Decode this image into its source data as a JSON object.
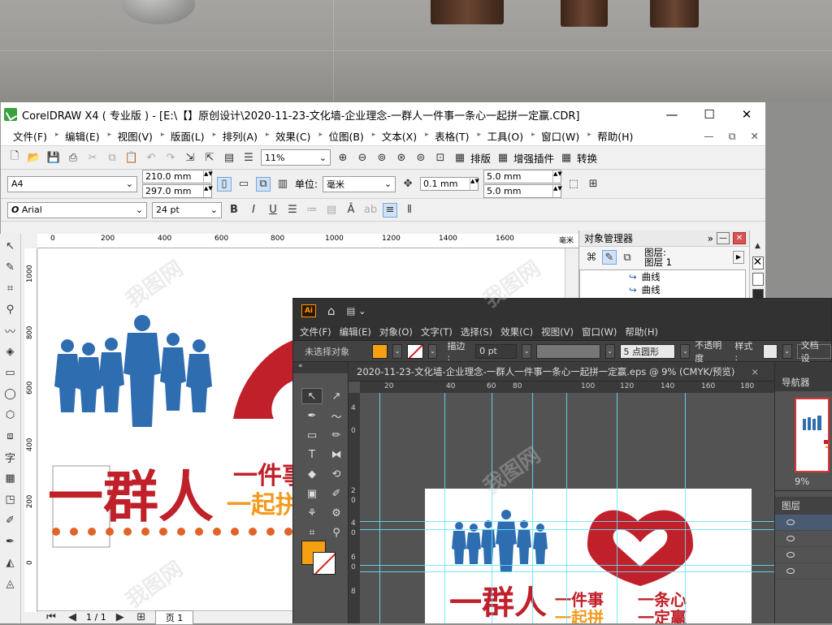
{
  "corel": {
    "title": "CorelDRAW X4 ( 专业版 ) - [E:\\【】原创设计\\2020-11-23-文化墙-企业理念-一群人一件事一条心一起拼一定赢.CDR]",
    "window_controls": [
      "—",
      "☐",
      "✕"
    ],
    "menu": [
      "文件(F)",
      "编辑(E)",
      "视图(V)",
      "版面(L)",
      "排列(A)",
      "效果(C)",
      "位图(B)",
      "文本(X)",
      "表格(T)",
      "工具(O)",
      "窗口(W)",
      "帮助(H)"
    ],
    "menu_right": [
      "—",
      "⧉",
      "✕"
    ],
    "toolbar1": {
      "zoom": "11%",
      "buttons": [
        "排版",
        "增强插件",
        "转换"
      ]
    },
    "toolbar2": {
      "page_size": "A4",
      "width": "210.0 mm",
      "height": "297.0 mm",
      "unit_label": "单位:",
      "unit": "毫米",
      "nudge": "0.1 mm",
      "dup_x": "5.0 mm",
      "dup_y": "5.0 mm"
    },
    "toolbar3": {
      "font": "Arial",
      "font_size": "24 pt",
      "font_glyph": "O"
    },
    "hruler": {
      "ticks": [
        "0",
        "200",
        "400",
        "600",
        "800",
        "1000",
        "1200",
        "1400",
        "1600"
      ],
      "unit": "毫米"
    },
    "vruler": {
      "ticks": [
        "1000",
        "800",
        "600",
        "400",
        "200",
        "0"
      ]
    },
    "status": {
      "page_counter": "1 / 1",
      "page_tab": "页 1"
    },
    "object_manager": {
      "title": "对象管理器",
      "layers": [
        "图层:",
        "图层 1"
      ],
      "items": [
        "曲线",
        "曲线"
      ]
    },
    "palette_colors": [
      "#ffffff",
      "#2b2b2b",
      "#1a1a1a"
    ]
  },
  "illustrator": {
    "logo": "Ai",
    "menu": [
      "文件(F)",
      "编辑(E)",
      "对象(O)",
      "文字(T)",
      "选择(S)",
      "效果(C)",
      "视图(V)",
      "窗口(W)",
      "帮助(H)"
    ],
    "control": {
      "selection": "未选择对象",
      "fill_color": "#f4a012",
      "stroke_label": "描边 :",
      "stroke_value": "0 pt",
      "brush": "5 点圆形",
      "opacity_label": "不透明度",
      "style_label": "样式 :",
      "doc_setup": "文档设"
    },
    "tab_title": "2020-11-23-文化墙-企业理念-一群人一件事一条心一起拼一定赢.eps @ 9% (CMYK/预览)",
    "tab_close": "×",
    "hruler": {
      "ticks": [
        "20",
        "40",
        "60",
        "80",
        "100",
        "120",
        "140",
        "160",
        "180"
      ]
    },
    "vruler": {
      "ticks": [
        "4",
        "0",
        "2",
        "0",
        "4",
        "0",
        "6",
        "0",
        "8"
      ]
    },
    "navigator": {
      "title": "导航器",
      "zoom": "9%"
    },
    "layers": {
      "title": "图层"
    }
  },
  "artwork": {
    "headline_1": "一群人",
    "headline_2": "一件事",
    "headline_3": "一条心",
    "headline_4": "一起拼",
    "headline_5": "一定赢",
    "colors": {
      "red": "#c0202a",
      "blue": "#2f6db1",
      "orange": "#f29a1d"
    }
  },
  "watermark": "我图网"
}
